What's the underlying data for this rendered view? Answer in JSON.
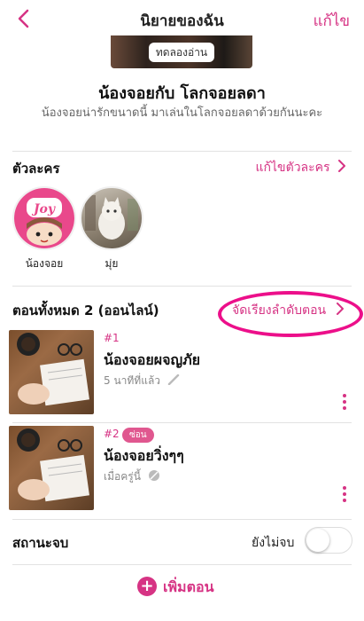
{
  "header": {
    "title": "นิยายของฉัน",
    "edit_label": "แก้ไข"
  },
  "cover": {
    "try_read_label": "ทดลองอ่าน"
  },
  "novel": {
    "name": "น้องจอยกับ โลกจอยลดา",
    "description": "น้องจอยน่ารักขนาดนี้ มาเล่นในโลกจอยลดาด้วยกันนะคะ"
  },
  "characters_section": {
    "title": "ตัวละคร",
    "edit_link": "แก้ไขตัวละคร",
    "items": [
      {
        "name": "น้องจอย",
        "avatar_text": "Joy"
      },
      {
        "name": "มุ่ย"
      }
    ]
  },
  "episodes_section": {
    "title": "ตอนทั้งหมด 2 (ออนไลน์)",
    "sort_link": "จัดเรียงลำดับตอน",
    "items": [
      {
        "number": "#1",
        "title": "น้องจอยผจญภัย",
        "time": "5 นาทีที่แล้ว",
        "badge": ""
      },
      {
        "number": "#2",
        "title": "น้องจอยวิ่งๆๆ",
        "time": "เมื่อครู่นี้",
        "badge": "ซ่อน"
      }
    ]
  },
  "status_section": {
    "label": "สถานะจบ",
    "value": "ยังไม่จบ",
    "toggle_on": false
  },
  "footer": {
    "add_label": "เพิ่มตอน",
    "plus_symbol": "+"
  },
  "colors": {
    "accent": "#d63384",
    "highlight_ellipse": "#ec0f8a",
    "badge": "#e0578f"
  }
}
